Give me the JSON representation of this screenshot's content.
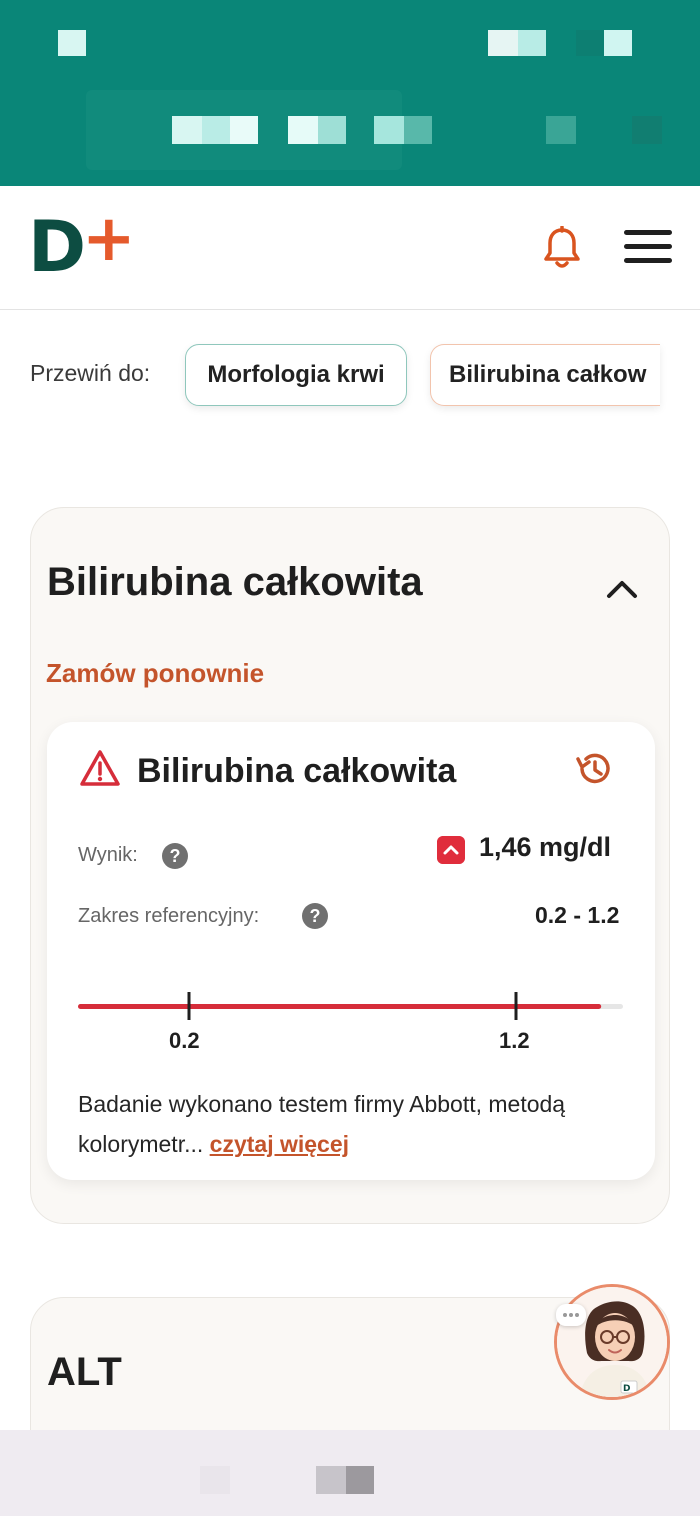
{
  "header": {
    "logo_letter": "D",
    "logo_plus": "+",
    "notifications_icon": "bell-icon",
    "menu_icon": "hamburger-menu-icon"
  },
  "scroll_to": {
    "label": "Przewiń do:",
    "chips": [
      "Morfologia krwi",
      "Bilirubina całkow"
    ]
  },
  "card": {
    "title": "Bilirubina całkowita",
    "reorder": "Zamów ponownie",
    "result": {
      "title": "Bilirubina całkowita",
      "result_label": "Wynik:",
      "result_value": "1,46 mg/dl",
      "range_label": "Zakres referencyjny:",
      "range_value": "0.2 - 1.2",
      "help": "?",
      "tick_low": "0.2",
      "tick_high": "1.2",
      "bar_fill_fraction": 0.96,
      "description": "Badanie wykonano testem firmy Abbott, metodą kolorymetr...",
      "read_more": "czytaj więcej"
    }
  },
  "card2": {
    "title": "ALT"
  },
  "colors": {
    "brand_teal": "#0a8678",
    "brand_dark": "#0d4d42",
    "accent_orange": "#e55a2c",
    "link_orange": "#c4542b",
    "alert_red": "#e02d3c",
    "bar_red": "#d62d3a"
  }
}
